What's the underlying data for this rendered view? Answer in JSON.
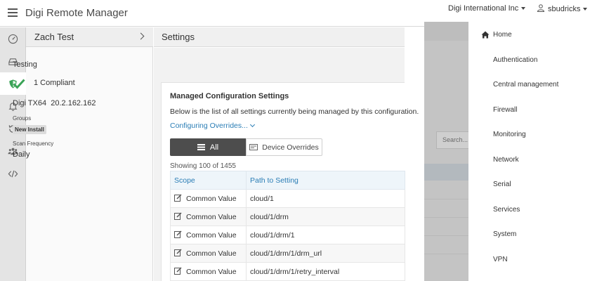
{
  "app": {
    "title": "Digi Remote Manager",
    "organization": "Digi International Inc",
    "user": "sbudricks"
  },
  "rail": {
    "items": [
      "dashboard-icon",
      "device-icon",
      "shield-icon",
      "bell-icon",
      "history-icon",
      "users-icon",
      "code-icon"
    ],
    "active_index": 2
  },
  "device_panel": {
    "device_name": "Zach Test",
    "configuration_name": "Testing",
    "compliance": "1 Compliant",
    "device_type": "Digi TX64",
    "device_version": "20.2.162.162",
    "groups_label": "Groups",
    "group_badge": "New Install",
    "scan_frequency_label": "Scan Frequency",
    "scan_frequency_value": "Daily"
  },
  "settings": {
    "header": "Settings",
    "card_title": "Managed Configuration Settings",
    "description": "Below is the list of all settings currently being managed by this configuration.",
    "overrides_link": "Configuring Overrides...",
    "tabs": {
      "all": "All",
      "device_overrides": "Device Overrides"
    },
    "showing": "Showing 100 of 1455",
    "columns": [
      "Scope",
      "Path to Setting"
    ],
    "rows": [
      {
        "scope": "Common Value",
        "path": "cloud/1"
      },
      {
        "scope": "Common Value",
        "path": "cloud/1/drm"
      },
      {
        "scope": "Common Value",
        "path": "cloud/1/drm/1"
      },
      {
        "scope": "Common Value",
        "path": "cloud/1/drm/1/drm_url"
      },
      {
        "scope": "Common Value",
        "path": "cloud/1/drm/1/retry_interval"
      }
    ]
  },
  "backdrop": {
    "search_placeholder": "Search..."
  },
  "side_menu": {
    "items": [
      "Home",
      "Authentication",
      "Central management",
      "Firewall",
      "Monitoring",
      "Network",
      "Serial",
      "Services",
      "System",
      "VPN"
    ]
  },
  "colors": {
    "accent_blue": "#2a7db5",
    "compliant_green": "#3aa356",
    "tab_active": "#4d4d4d",
    "rail_bg": "#e4e4e4"
  }
}
